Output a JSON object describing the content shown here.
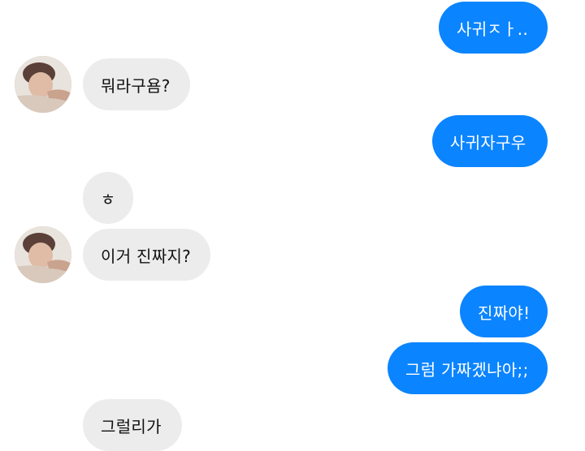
{
  "colors": {
    "outgoing_bubble": "#0b84ff",
    "incoming_bubble": "#ececec",
    "outgoing_text": "#ffffff",
    "incoming_text": "#111111",
    "background": "#ffffff"
  },
  "messages": [
    {
      "sender": "me",
      "text": "사귀ㅈㅏ.."
    },
    {
      "sender": "other",
      "text": "뭐라구욤?",
      "avatar": "profile-photo"
    },
    {
      "sender": "me",
      "text": "사귀자구우"
    },
    {
      "sender": "other",
      "text": "ㅎ"
    },
    {
      "sender": "other",
      "text": "이거 진짜지?",
      "avatar": "profile-photo"
    },
    {
      "sender": "me",
      "text": "진짜야!"
    },
    {
      "sender": "me",
      "text": "그럼 가짜겠냐아;;"
    },
    {
      "sender": "other",
      "text": "그럴리가"
    }
  ]
}
